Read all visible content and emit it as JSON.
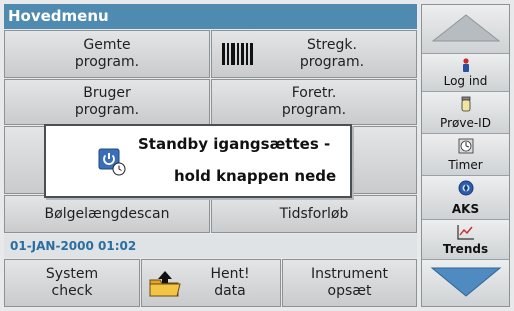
{
  "title": "Hovedmenu",
  "menu": {
    "saved_programs": "Gemte\nprogram.",
    "barcode_programs": "Stregk.\nprogram.",
    "user_programs": "Bruger\nprogram.",
    "favorite_programs": "Foretr.\nprogram.",
    "wavelength_scan": "Bølgelængdescan",
    "time_course": "Tidsforløb"
  },
  "status": {
    "datetime": "01-JAN-2000  01:02"
  },
  "bottom": {
    "system_check": "System\ncheck",
    "retrieve_data": "Hent!\ndata",
    "instrument_setup": "Instrument\nopsæt"
  },
  "sidebar": {
    "login": "Log ind",
    "sample_id": "Prøve-ID",
    "timer": "Timer",
    "aks": "AKS",
    "trends": "Trends"
  },
  "dialog": {
    "line1": "Standby igangsættes -",
    "line2": "hold knappen nede"
  },
  "colors": {
    "title_bar": "#4f8bb0",
    "accent_text": "#2b6ea0"
  }
}
